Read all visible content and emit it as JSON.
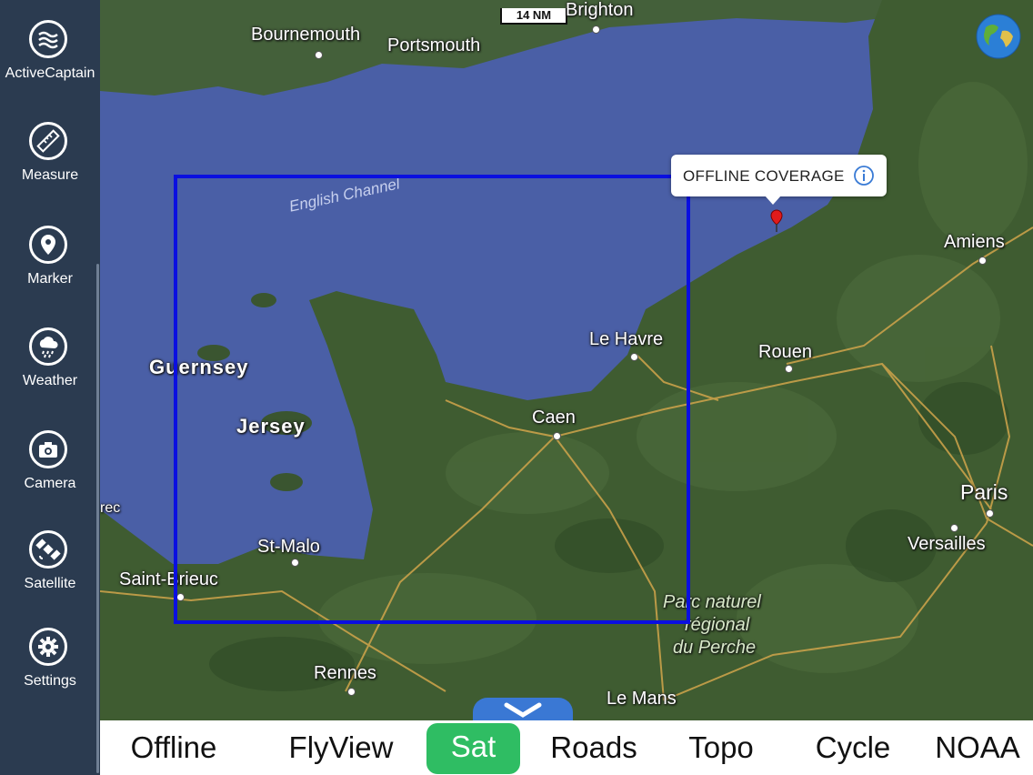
{
  "sidebar": {
    "items": [
      {
        "label": "ActiveCaptain",
        "icon": "activecaptain-waves-icon"
      },
      {
        "label": "Measure",
        "icon": "ruler-icon"
      },
      {
        "label": "Marker",
        "icon": "map-pin-icon"
      },
      {
        "label": "Weather",
        "icon": "cloud-rain-icon"
      },
      {
        "label": "Camera",
        "icon": "camera-icon"
      },
      {
        "label": "Satellite",
        "icon": "satellite-icon"
      },
      {
        "label": "Settings",
        "icon": "gear-icon"
      }
    ]
  },
  "map": {
    "scale_label": "14 NM",
    "callout": {
      "text": "OFFLINE COVERAGE",
      "icon": "info-icon"
    },
    "places": {
      "bournemouth": "Bournemouth",
      "portsmouth": "Portsmouth",
      "brighton": "Brighton",
      "english_channel": "English Channel",
      "guernsey": "Guernsey",
      "jersey": "Jersey",
      "st_malo": "St-Malo",
      "saint_brieuc": "Saint-Brieuc",
      "rennes": "Rennes",
      "caen": "Caen",
      "le_havre": "Le Havre",
      "rouen": "Rouen",
      "amiens": "Amiens",
      "paris": "Paris",
      "versailles": "Versailles",
      "le_mans": "Le Mans",
      "parc_line1": "Parc naturel",
      "parc_line2": "régional",
      "parc_line3": "du Perche",
      "partial_left": "rec"
    },
    "colors": {
      "coverage_box": "#0a0fe0",
      "sea": "#4a5fa6",
      "land": "#3d5a2f",
      "active_tab": "#2fbd63"
    }
  },
  "tabs": [
    {
      "label": "Offline",
      "active": false
    },
    {
      "label": "FlyView",
      "active": false
    },
    {
      "label": "Sat",
      "active": true
    },
    {
      "label": "Roads",
      "active": false
    },
    {
      "label": "Topo",
      "active": false
    },
    {
      "label": "Cycle",
      "active": false
    },
    {
      "label": "NOAA",
      "active": false
    }
  ]
}
